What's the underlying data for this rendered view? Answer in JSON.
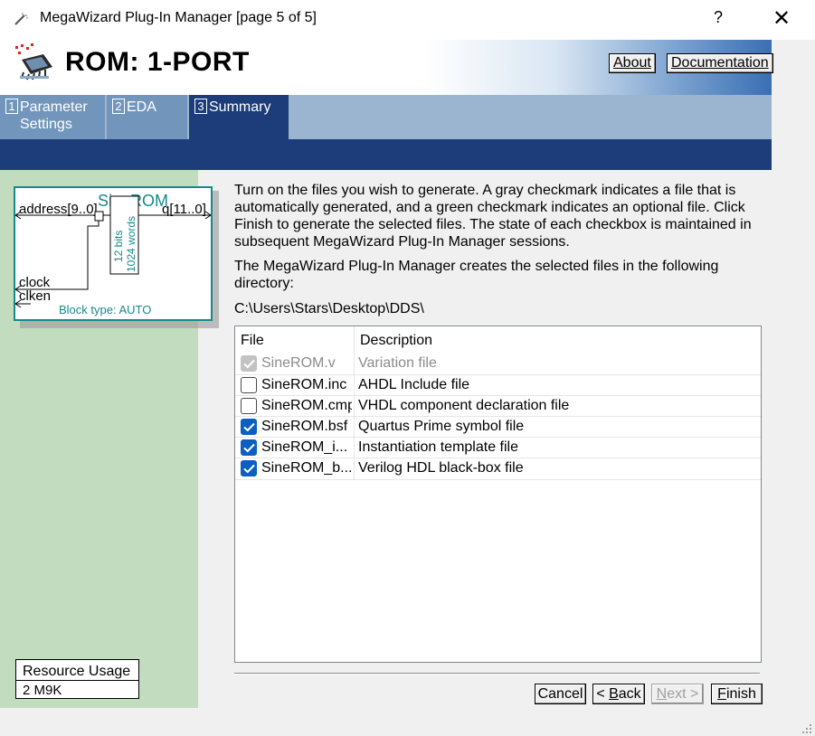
{
  "window": {
    "title": "MegaWizard Plug-In Manager [page 5 of 5]",
    "help_glyph": "?",
    "close_glyph": "✕"
  },
  "header": {
    "title": "ROM: 1-PORT",
    "about_label": "About",
    "documentation_label": "Documentation"
  },
  "tabs": [
    {
      "num": "1",
      "label": "Parameter Settings",
      "line1": "Parameter",
      "line2": "Settings",
      "active": false
    },
    {
      "num": "2",
      "label": "EDA",
      "line1": "EDA",
      "line2": "",
      "active": false
    },
    {
      "num": "3",
      "label": "Summary",
      "line1": "Summary",
      "line2": "",
      "active": true
    }
  ],
  "symbol": {
    "name": "SineROM",
    "ports": {
      "address": "address[9..0]",
      "q": "q[11..0]",
      "clock": "clock",
      "clken": "clken"
    },
    "bits_label": "12 bits",
    "words_label": "1024 words",
    "block_type": "Block type: AUTO"
  },
  "resource": {
    "header": "Resource Usage",
    "value": "2 M9K"
  },
  "content": {
    "intro": "Turn on the files you wish to generate. A gray checkmark indicates a file that is automatically generated, and a green checkmark indicates an optional file. Click Finish to generate the selected files. The state of each checkbox is maintained in subsequent MegaWizard Plug-In Manager sessions.",
    "intro_lines": [
      "Turn on the files you wish to generate. A gray checkmark indicates a file that is",
      "automatically generated, and a green checkmark indicates an optional file. Click",
      "Finish to generate the selected files. The state of each checkbox is maintained in",
      "subsequent MegaWizard Plug-In Manager sessions."
    ],
    "dir_intro_lines": [
      "The MegaWizard Plug-In Manager creates the selected files in the following",
      "directory:"
    ],
    "directory": "C:\\Users\\Stars\\Desktop\\DDS\\"
  },
  "file_table": {
    "columns": [
      "File",
      "Description"
    ],
    "rows": [
      {
        "file": "SineROM.v",
        "description": "Variation file",
        "state": "gray"
      },
      {
        "file": "SineROM.inc",
        "description": "AHDL Include file",
        "state": "unchecked"
      },
      {
        "file": "SineROM.cmp",
        "description": "VHDL component declaration file",
        "state": "unchecked"
      },
      {
        "file": "SineROM.bsf",
        "description": "Quartus Prime symbol file",
        "state": "checked"
      },
      {
        "file": "SineROM_i...",
        "description": "Instantiation template file",
        "state": "checked"
      },
      {
        "file": "SineROM_b...",
        "description": "Verilog HDL black-box file",
        "state": "checked"
      }
    ]
  },
  "buttons": {
    "cancel": "Cancel",
    "back_prefix": "< ",
    "back_key": "B",
    "back_rest": "ack",
    "next_key": "N",
    "next_rest": "ext >",
    "finish_key": "F",
    "finish_rest": "inish"
  },
  "colors": {
    "accent_blue": "#1c3d79",
    "tab_blue": "#7296bb",
    "left_panel_green": "#c2dcbf",
    "symbol_teal": "#158a8a",
    "checkbox_blue": "#0a5fc1"
  }
}
